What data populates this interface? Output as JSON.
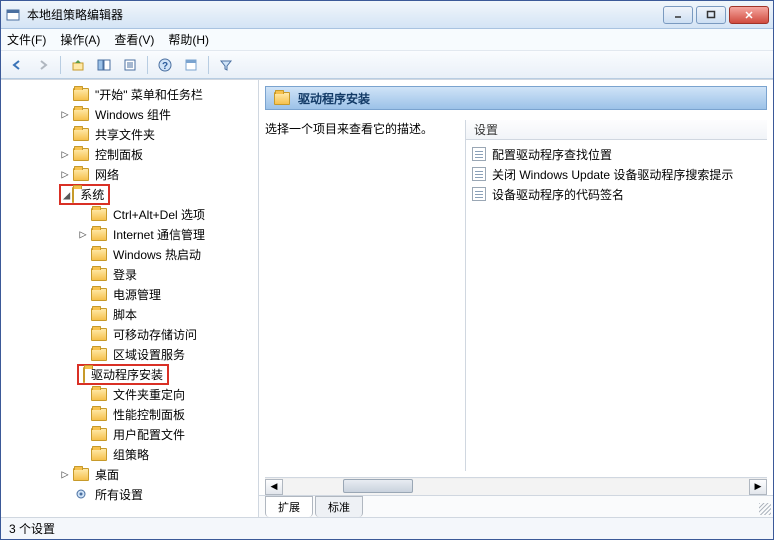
{
  "window": {
    "title": "本地组策略编辑器"
  },
  "menus": {
    "file": "文件(F)",
    "action": "操作(A)",
    "view": "查看(V)",
    "help": "帮助(H)"
  },
  "tree": {
    "items": [
      {
        "label": "\"开始\" 菜单和任务栏",
        "indent": "ind2",
        "tw": ""
      },
      {
        "label": "Windows 组件",
        "indent": "ind2",
        "tw": "▷"
      },
      {
        "label": "共享文件夹",
        "indent": "ind2",
        "tw": ""
      },
      {
        "label": "控制面板",
        "indent": "ind2",
        "tw": "▷"
      },
      {
        "label": "网络",
        "indent": "ind2",
        "tw": "▷"
      },
      {
        "label": "系统",
        "indent": "ind2",
        "tw": "◢",
        "highlight": true
      },
      {
        "label": "Ctrl+Alt+Del 选项",
        "indent": "ind3",
        "tw": ""
      },
      {
        "label": "Internet 通信管理",
        "indent": "ind3",
        "tw": "▷"
      },
      {
        "label": "Windows 热启动",
        "indent": "ind3",
        "tw": ""
      },
      {
        "label": "登录",
        "indent": "ind3",
        "tw": ""
      },
      {
        "label": "电源管理",
        "indent": "ind3",
        "tw": ""
      },
      {
        "label": "脚本",
        "indent": "ind3",
        "tw": ""
      },
      {
        "label": "可移动存储访问",
        "indent": "ind3",
        "tw": ""
      },
      {
        "label": "区域设置服务",
        "indent": "ind3",
        "tw": ""
      },
      {
        "label": "驱动程序安装",
        "indent": "ind3",
        "tw": "",
        "highlight": true
      },
      {
        "label": "文件夹重定向",
        "indent": "ind3",
        "tw": ""
      },
      {
        "label": "性能控制面板",
        "indent": "ind3",
        "tw": ""
      },
      {
        "label": "用户配置文件",
        "indent": "ind3",
        "tw": ""
      },
      {
        "label": "组策略",
        "indent": "ind3",
        "tw": ""
      },
      {
        "label": "桌面",
        "indent": "ind2",
        "tw": "▷"
      },
      {
        "label": "所有设置",
        "indent": "ind2",
        "tw": "",
        "gear": true
      }
    ]
  },
  "right": {
    "header": "驱动程序安装",
    "description_prompt": "选择一个项目来查看它的描述。",
    "settings_header": "设置",
    "items": [
      "配置驱动程序查找位置",
      "关闭 Windows Update 设备驱动程序搜索提示",
      "设备驱动程序的代码签名"
    ]
  },
  "tabs": {
    "extended": "扩展",
    "standard": "标准"
  },
  "status": "3 个设置"
}
